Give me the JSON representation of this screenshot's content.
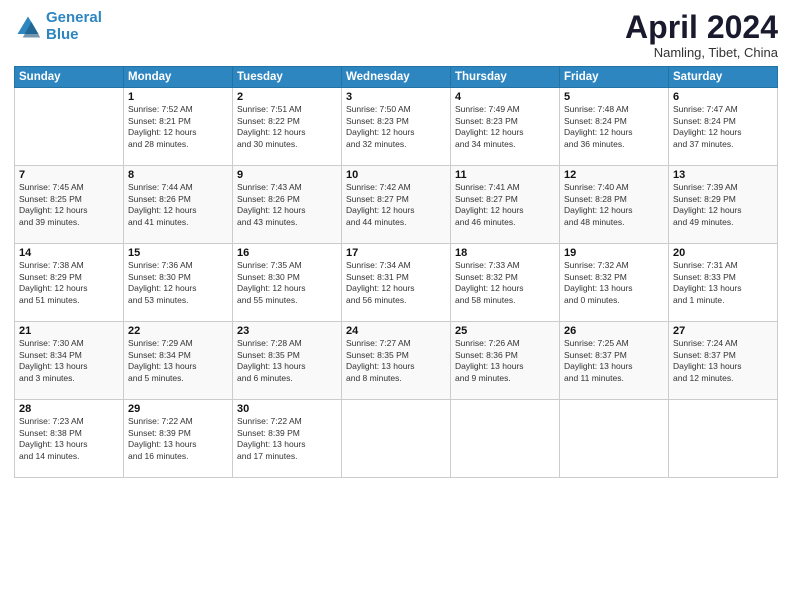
{
  "logo": {
    "line1": "General",
    "line2": "Blue"
  },
  "title": "April 2024",
  "subtitle": "Namling, Tibet, China",
  "days_header": [
    "Sunday",
    "Monday",
    "Tuesday",
    "Wednesday",
    "Thursday",
    "Friday",
    "Saturday"
  ],
  "weeks": [
    [
      {
        "num": "",
        "info": ""
      },
      {
        "num": "1",
        "info": "Sunrise: 7:52 AM\nSunset: 8:21 PM\nDaylight: 12 hours\nand 28 minutes."
      },
      {
        "num": "2",
        "info": "Sunrise: 7:51 AM\nSunset: 8:22 PM\nDaylight: 12 hours\nand 30 minutes."
      },
      {
        "num": "3",
        "info": "Sunrise: 7:50 AM\nSunset: 8:23 PM\nDaylight: 12 hours\nand 32 minutes."
      },
      {
        "num": "4",
        "info": "Sunrise: 7:49 AM\nSunset: 8:23 PM\nDaylight: 12 hours\nand 34 minutes."
      },
      {
        "num": "5",
        "info": "Sunrise: 7:48 AM\nSunset: 8:24 PM\nDaylight: 12 hours\nand 36 minutes."
      },
      {
        "num": "6",
        "info": "Sunrise: 7:47 AM\nSunset: 8:24 PM\nDaylight: 12 hours\nand 37 minutes."
      }
    ],
    [
      {
        "num": "7",
        "info": "Sunrise: 7:45 AM\nSunset: 8:25 PM\nDaylight: 12 hours\nand 39 minutes."
      },
      {
        "num": "8",
        "info": "Sunrise: 7:44 AM\nSunset: 8:26 PM\nDaylight: 12 hours\nand 41 minutes."
      },
      {
        "num": "9",
        "info": "Sunrise: 7:43 AM\nSunset: 8:26 PM\nDaylight: 12 hours\nand 43 minutes."
      },
      {
        "num": "10",
        "info": "Sunrise: 7:42 AM\nSunset: 8:27 PM\nDaylight: 12 hours\nand 44 minutes."
      },
      {
        "num": "11",
        "info": "Sunrise: 7:41 AM\nSunset: 8:27 PM\nDaylight: 12 hours\nand 46 minutes."
      },
      {
        "num": "12",
        "info": "Sunrise: 7:40 AM\nSunset: 8:28 PM\nDaylight: 12 hours\nand 48 minutes."
      },
      {
        "num": "13",
        "info": "Sunrise: 7:39 AM\nSunset: 8:29 PM\nDaylight: 12 hours\nand 49 minutes."
      }
    ],
    [
      {
        "num": "14",
        "info": "Sunrise: 7:38 AM\nSunset: 8:29 PM\nDaylight: 12 hours\nand 51 minutes."
      },
      {
        "num": "15",
        "info": "Sunrise: 7:36 AM\nSunset: 8:30 PM\nDaylight: 12 hours\nand 53 minutes."
      },
      {
        "num": "16",
        "info": "Sunrise: 7:35 AM\nSunset: 8:30 PM\nDaylight: 12 hours\nand 55 minutes."
      },
      {
        "num": "17",
        "info": "Sunrise: 7:34 AM\nSunset: 8:31 PM\nDaylight: 12 hours\nand 56 minutes."
      },
      {
        "num": "18",
        "info": "Sunrise: 7:33 AM\nSunset: 8:32 PM\nDaylight: 12 hours\nand 58 minutes."
      },
      {
        "num": "19",
        "info": "Sunrise: 7:32 AM\nSunset: 8:32 PM\nDaylight: 13 hours\nand 0 minutes."
      },
      {
        "num": "20",
        "info": "Sunrise: 7:31 AM\nSunset: 8:33 PM\nDaylight: 13 hours\nand 1 minute."
      }
    ],
    [
      {
        "num": "21",
        "info": "Sunrise: 7:30 AM\nSunset: 8:34 PM\nDaylight: 13 hours\nand 3 minutes."
      },
      {
        "num": "22",
        "info": "Sunrise: 7:29 AM\nSunset: 8:34 PM\nDaylight: 13 hours\nand 5 minutes."
      },
      {
        "num": "23",
        "info": "Sunrise: 7:28 AM\nSunset: 8:35 PM\nDaylight: 13 hours\nand 6 minutes."
      },
      {
        "num": "24",
        "info": "Sunrise: 7:27 AM\nSunset: 8:35 PM\nDaylight: 13 hours\nand 8 minutes."
      },
      {
        "num": "25",
        "info": "Sunrise: 7:26 AM\nSunset: 8:36 PM\nDaylight: 13 hours\nand 9 minutes."
      },
      {
        "num": "26",
        "info": "Sunrise: 7:25 AM\nSunset: 8:37 PM\nDaylight: 13 hours\nand 11 minutes."
      },
      {
        "num": "27",
        "info": "Sunrise: 7:24 AM\nSunset: 8:37 PM\nDaylight: 13 hours\nand 12 minutes."
      }
    ],
    [
      {
        "num": "28",
        "info": "Sunrise: 7:23 AM\nSunset: 8:38 PM\nDaylight: 13 hours\nand 14 minutes."
      },
      {
        "num": "29",
        "info": "Sunrise: 7:22 AM\nSunset: 8:39 PM\nDaylight: 13 hours\nand 16 minutes."
      },
      {
        "num": "30",
        "info": "Sunrise: 7:22 AM\nSunset: 8:39 PM\nDaylight: 13 hours\nand 17 minutes."
      },
      {
        "num": "",
        "info": ""
      },
      {
        "num": "",
        "info": ""
      },
      {
        "num": "",
        "info": ""
      },
      {
        "num": "",
        "info": ""
      }
    ]
  ]
}
